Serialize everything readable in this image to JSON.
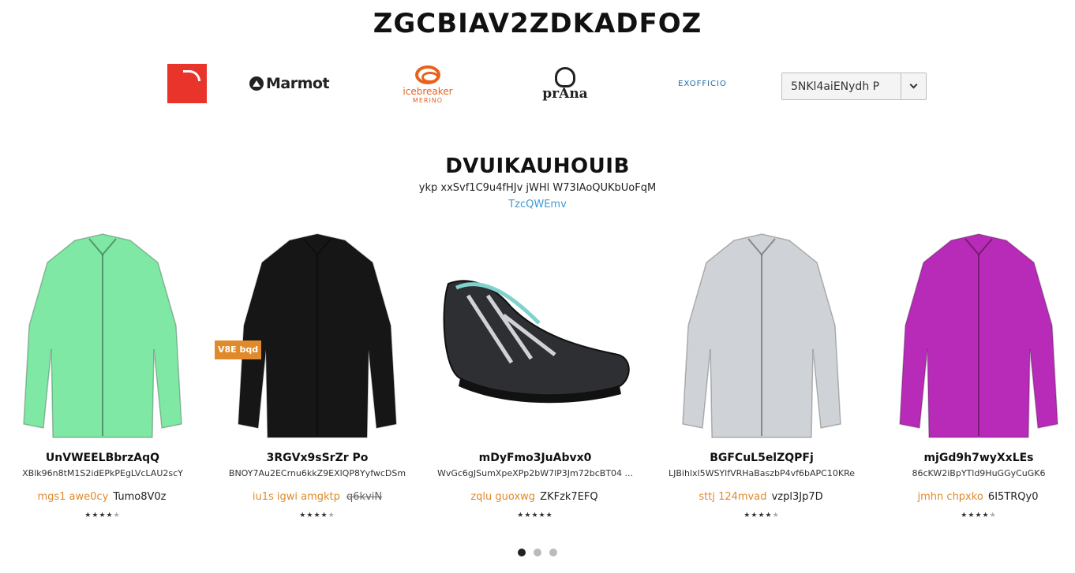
{
  "page": {
    "title": "ZGCBIAV2ZDKADFOZ"
  },
  "brands": {
    "tnf_text": "THE NORTH FACE",
    "marmot": "Marmot",
    "icebreaker_name": "icebreaker",
    "icebreaker_sub": "MERINO",
    "prana": "prAna",
    "exofficio": "EXOFFICIO",
    "select_value": "5NKl4aiENydh P"
  },
  "section": {
    "title": "DVUIKAUHOUIB",
    "subtitle": "ykp xxSvf1C9u4fHJv jWHl W73IAoQUKbUoFqM",
    "link": "TzcQWEmv"
  },
  "badge": "V8E bqd",
  "products": [
    {
      "name": "UnVWEELBbrzAqQ",
      "desc": "XBlk96n8tM1S2idEPkPEgLVcLAU2scY",
      "sale": "mgs1 awe0cy",
      "reg": "Tumo8V0z",
      "strike": "",
      "rating": 4,
      "color": "#7fe8a5",
      "kind": "jacket"
    },
    {
      "name": "3RGVx9sSrZr Po",
      "desc": "BNOY7Au2ECrnu6kkZ9EXlQP8YyfwcDSm",
      "sale": "iu1s igwi amgktp",
      "reg": "",
      "strike": "q6kviN",
      "rating": 4,
      "color": "#161616",
      "kind": "jacket"
    },
    {
      "name": "mDyFmo3JuAbvx0",
      "desc": "WvGc6gJSumXpeXPp2bW7lP3Jm72bcBT04 ...",
      "sale": "zqlu guoxwg",
      "reg": "ZKFzk7EFQ",
      "strike": "",
      "rating": 5,
      "color": "#2e2f33",
      "kind": "shoe"
    },
    {
      "name": "BGFCuL5elZQPFj",
      "desc": "LJBihlxl5WSYlfVRHaBaszbP4vf6bAPC10KRe",
      "sale": "sttj 124mvad",
      "reg": "vzpl3Jp7D",
      "strike": "",
      "rating": 4,
      "color": "#cfd2d6",
      "kind": "jacket"
    },
    {
      "name": "mjGd9h7wyXxLEs",
      "desc": "86cKW2iBpYTld9HuGGyCuGK6",
      "sale": "jmhn chpxko",
      "reg": "6I5TRQy0",
      "strike": "",
      "rating": 4,
      "color": "#b82bb8",
      "kind": "jacket"
    }
  ],
  "pager": {
    "count": 3,
    "active": 0
  },
  "colors": {
    "accent": "#e08a2b",
    "link": "#3f9ad6"
  }
}
